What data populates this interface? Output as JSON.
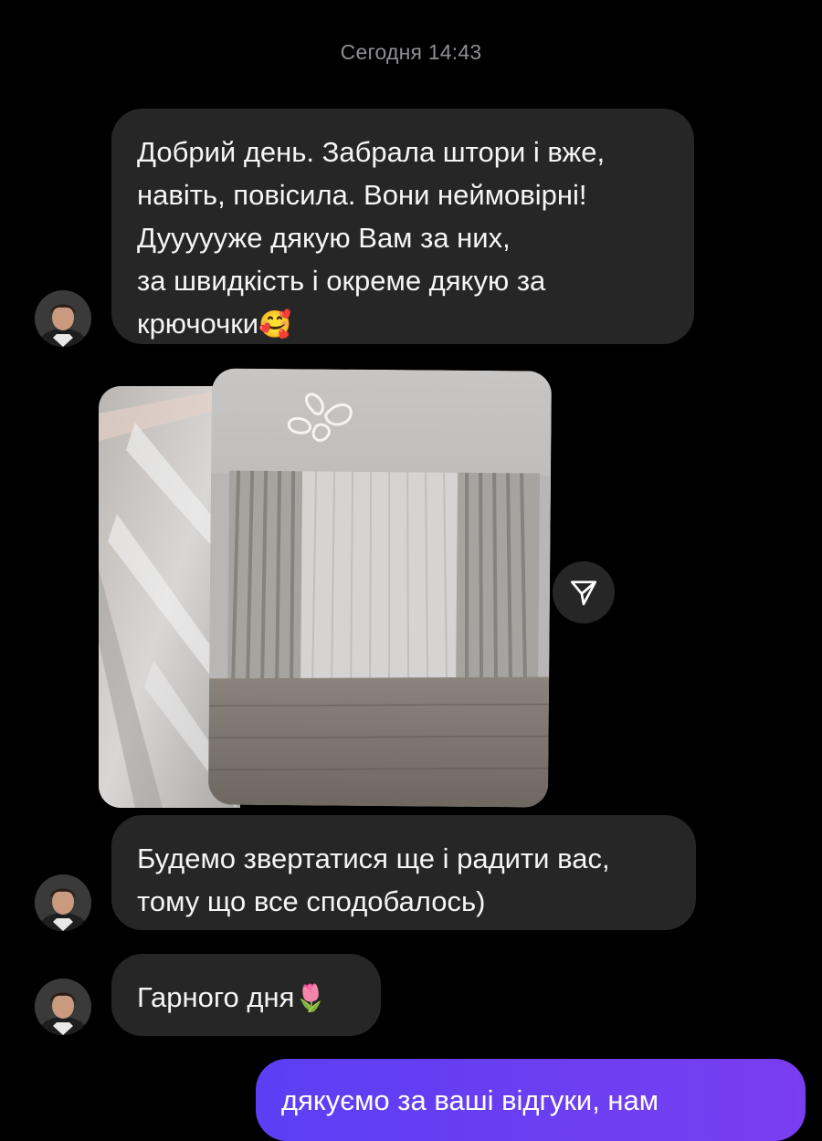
{
  "chat": {
    "timestamp": "Сегодня 14:43",
    "messages": [
      {
        "lines": [
          "Добрий день. Забрала штори і вже,",
          "навіть, повісила. Вони неймовірні!",
          "Дуууууже дякую Вам за них,",
          "за швидкість і окреме дякую за",
          "крючочки"
        ],
        "emoji": "🥰"
      },
      {
        "lines": [
          "Будемо звертатися ще і радити вас,",
          "тому що все сподобалось)"
        ]
      },
      {
        "lines": [
          "Гарного дня"
        ],
        "emoji": "🌷"
      }
    ],
    "outgoing": {
      "text": "дякуємо за ваші відгуки, нам"
    },
    "icons": {
      "share": "share-send-icon",
      "avatar": "user-avatar"
    },
    "colors": {
      "background": "#000000",
      "incoming_bubble": "#262626",
      "outgoing_bubble": "#6b3ff0",
      "timestamp": "#8e8e93"
    }
  }
}
